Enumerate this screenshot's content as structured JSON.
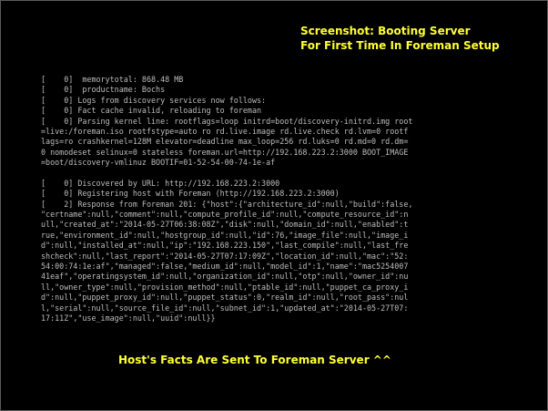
{
  "captions": {
    "top_line1": "Screenshot: Booting Server",
    "top_line2": "For First Time In Foreman Setup",
    "bottom": "Host's Facts Are Sent To Foreman Server ^^"
  },
  "console": {
    "block1": [
      "[    0]  memorytotal: 868.48 MB",
      "[    0]  productname: Bochs",
      "[    0] Logs from discovery services now follows:",
      "[    0] Fact cache invalid, reloading to foreman",
      "[    0] Parsing kernel line: rootflags=loop initrd=boot/discovery-initrd.img root",
      "=live:/foreman.iso rootfstype=auto ro rd.live.image rd.live.check rd.lvm=0 rootf",
      "lags=ro crashkernel=128M elevator=deadline max_loop=256 rd.luks=0 rd.md=0 rd.dm=",
      "0 nomodeset selinux=0 stateless foreman.url=http://192.168.223.2:3000 BOOT_IMAGE",
      "=boot/discovery-vmlinuz BOOTIF=01-52-54-00-74-1e-af"
    ],
    "block2": [
      "[    0] Discovered by URL: http://192.168.223.2:3000",
      "[    0] Registering host with Foreman (http://192.168.223.2:3000)",
      "[    2] Response from Foreman 201: {\"host\":{\"architecture_id\":null,\"build\":false,",
      "\"certname\":null,\"comment\":null,\"compute_profile_id\":null,\"compute_resource_id\":n",
      "ull,\"created_at\":\"2014-05-27T06:38:08Z\",\"disk\":null,\"domain_id\":null,\"enabled\":t",
      "rue,\"environment_id\":null,\"hostgroup_id\":null,\"id\":76,\"image_file\":null,\"image_i",
      "d\":null,\"installed_at\":null,\"ip\":\"192.168.223.150\",\"last_compile\":null,\"last_fre",
      "shcheck\":null,\"last_report\":\"2014-05-27T07:17:09Z\",\"location_id\":null,\"mac\":\"52:",
      "54:00:74:1e:af\",\"managed\":false,\"medium_id\":null,\"model_id\":1,\"name\":\"mac5254007",
      "41eaf\",\"operatingsystem_id\":null,\"organization_id\":null,\"otp\":null,\"owner_id\":nu",
      "ll,\"owner_type\":null,\"provision_method\":null,\"ptable_id\":null,\"puppet_ca_proxy_i",
      "d\":null,\"puppet_proxy_id\":null,\"puppet_status\":0,\"realm_id\":null,\"root_pass\":nul",
      "l,\"serial\":null,\"source_file_id\":null,\"subnet_id\":1,\"updated_at\":\"2014-05-27T07:",
      "17:11Z\",\"use_image\":null,\"uuid\":null}}"
    ]
  }
}
